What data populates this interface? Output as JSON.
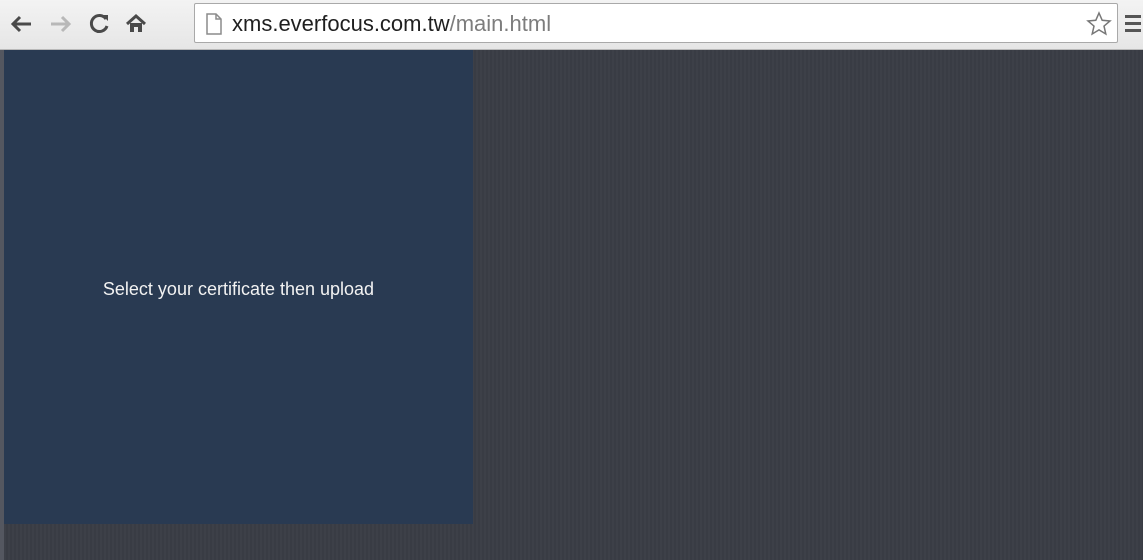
{
  "browser": {
    "url_host": "xms.everfocus.com.tw",
    "url_path": "/main.html",
    "icons": {
      "back": "back-arrow-icon",
      "forward": "forward-arrow-icon",
      "reload": "reload-icon",
      "home": "home-icon",
      "page": "page-icon",
      "bookmark": "bookmark-star-icon",
      "menu": "menu-icon"
    }
  },
  "page": {
    "upload_message": "Select your certificate then upload",
    "colors": {
      "panel": "#293a52",
      "background": "#3a3d45",
      "text": "#f2f2f2"
    }
  }
}
